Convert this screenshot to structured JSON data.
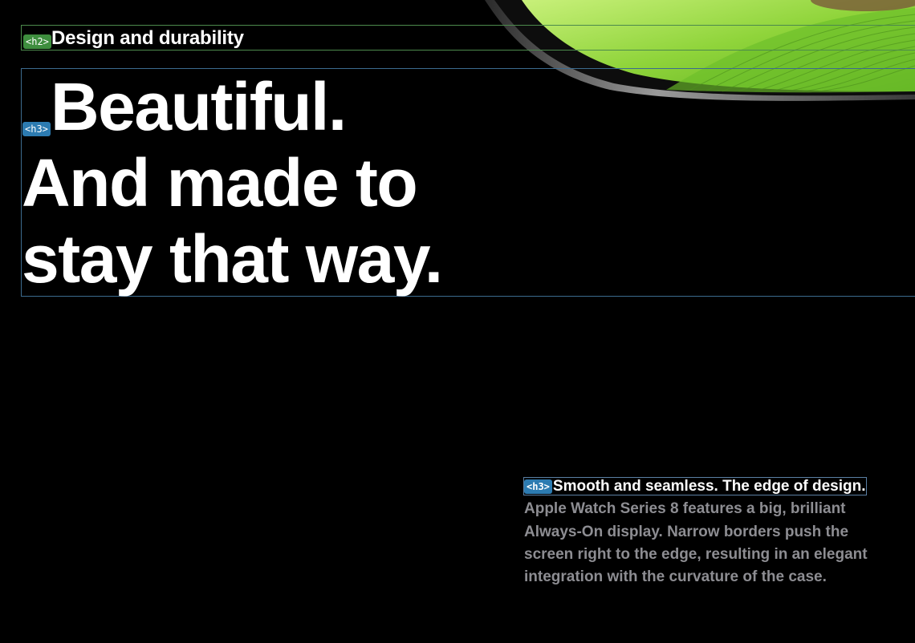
{
  "section": {
    "tag": "<h2>",
    "title": "Design and durability"
  },
  "headline": {
    "tag": "<h3>",
    "line1": "Beautiful.",
    "line2": "And made to",
    "line3": "stay that way."
  },
  "feature": {
    "tag": "<h3>",
    "lead": "Smooth and seamless. The edge of design.",
    "body": " Apple Watch Series 8 features a big, brilliant Always-On display. Narrow borders push the screen right to the edge, resulting in an elegant integration with the curvature of the case."
  },
  "colors": {
    "background": "#000000",
    "heading_tag": "#3e8e3e",
    "subheading_tag": "#2c7bb1",
    "body_text": "#8d8d92",
    "accent_green": "#8ccf3c"
  },
  "icons": {
    "hero": "watch-band-image"
  }
}
